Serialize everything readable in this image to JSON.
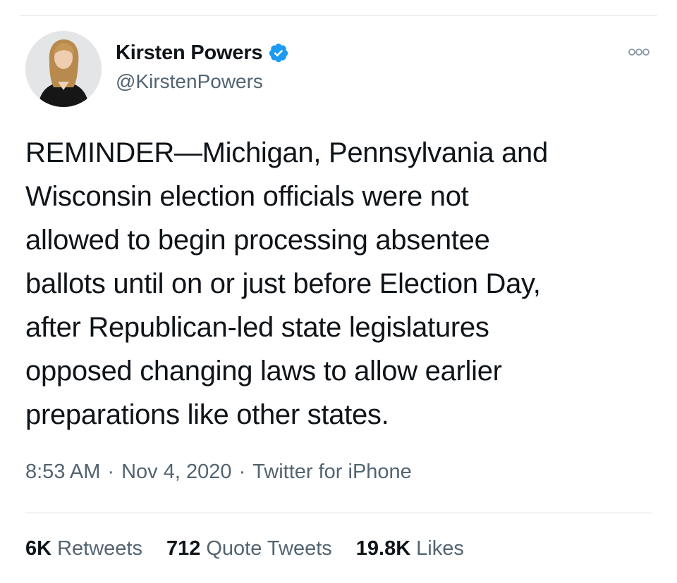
{
  "tweet": {
    "display_name": "Kirsten Powers",
    "handle": "@KirstenPowers",
    "verified_icon": "verified-badge-icon",
    "more_icon": "more-options-icon",
    "text": "REMINDER—Michigan, Pennsylvania and\nWisconsin election officials were not\nallowed to begin processing absentee\nballots until on or just before Election Day,\nafter Republican-led state legislatures\nopposed changing laws to allow earlier\npreparations like other states.",
    "time": "8:53 AM",
    "date": "Nov 4, 2020",
    "source": "Twitter for iPhone",
    "separator": "·"
  },
  "stats": {
    "retweets_count": "6K",
    "retweets_label": "Retweets",
    "quotes_count": "712",
    "quotes_label": "Quote Tweets",
    "likes_count": "19.8K",
    "likes_label": "Likes"
  },
  "colors": {
    "verified": "#1d9bf0",
    "text_primary": "#0f1419",
    "text_secondary": "#536471",
    "divider": "#dcdfe2"
  }
}
